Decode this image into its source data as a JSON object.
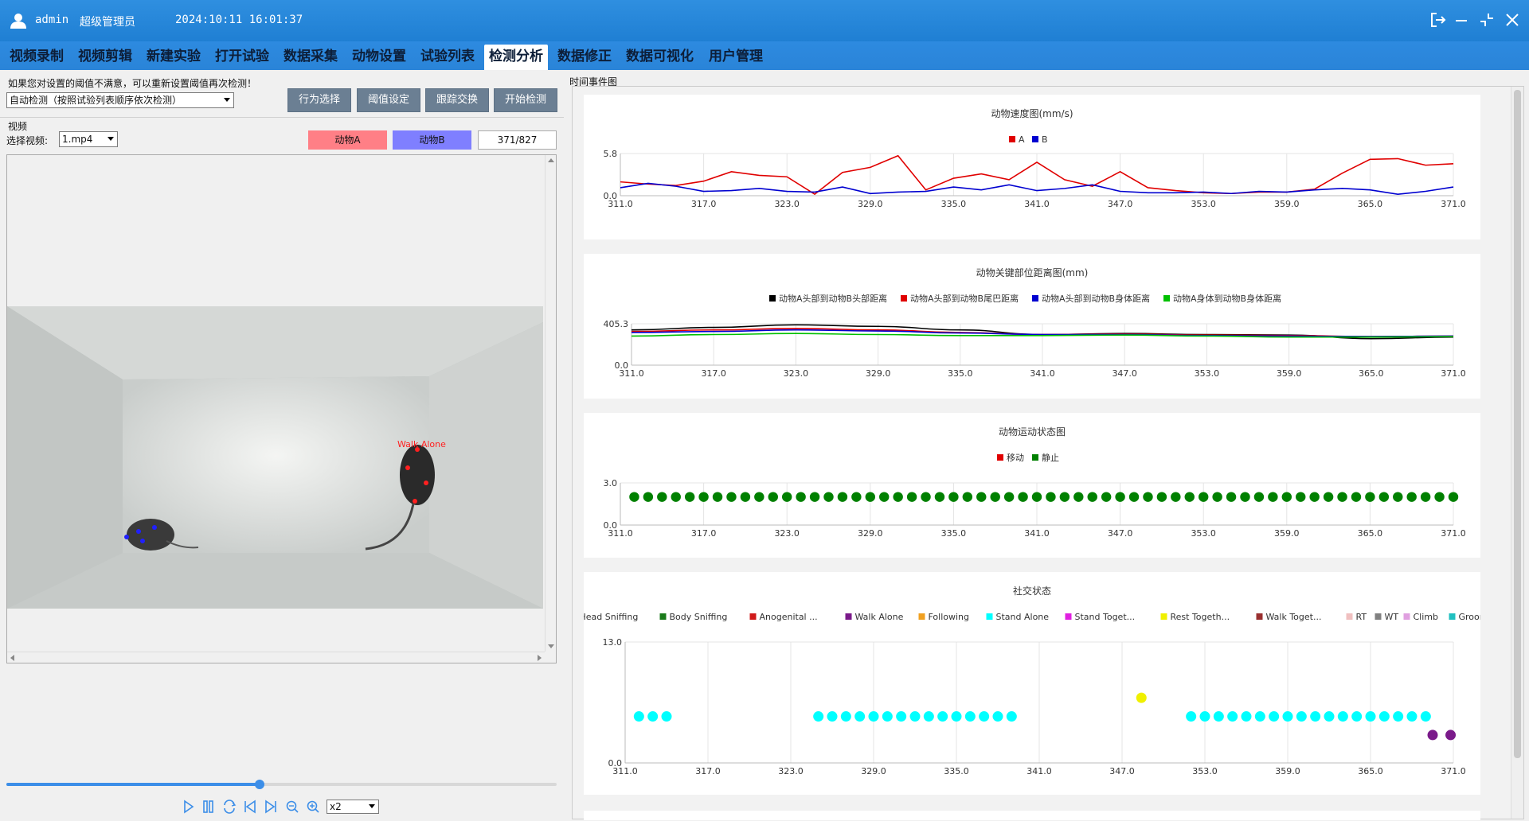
{
  "titlebar": {
    "user": "admin",
    "role": "超级管理员",
    "datetime": "2024:10:11 16:01:37"
  },
  "menu": {
    "items": [
      "视频录制",
      "视频剪辑",
      "新建实验",
      "打开试验",
      "数据采集",
      "动物设置",
      "试验列表",
      "检测分析",
      "数据修正",
      "数据可视化",
      "用户管理"
    ],
    "active": 7
  },
  "left": {
    "hint": "如果您对设置的阈值不满意，可以重新设置阈值再次检测！",
    "mode_select": "自动检测（按照试验列表顺序依次检测）",
    "buttons": {
      "behavior": "行为选择",
      "threshold": "阈值设定",
      "track_swap": "跟踪交换",
      "start": "开始检测"
    },
    "video_group": "视频",
    "select_video_label": "选择视频:",
    "video_file": "1.mp4",
    "animal_a": "动物A",
    "animal_b": "动物B",
    "frame_counter": "371/827",
    "overlay_label": "Walk Alone",
    "speed": "x2",
    "progress": 0.46,
    "colors": {
      "animal_a": "#ff7f86",
      "animal_b": "#7f7fff"
    }
  },
  "right": {
    "section_title": "时间事件图"
  },
  "chart_data": [
    {
      "type": "line",
      "title": "动物速度图(mm/s)",
      "x": [
        311,
        313,
        315,
        317,
        319,
        321,
        323,
        325,
        327,
        329,
        331,
        333,
        335,
        337,
        339,
        341,
        343,
        345,
        347,
        349,
        351,
        353,
        355,
        357,
        359,
        361,
        363,
        365,
        367,
        369,
        371
      ],
      "ylim": [
        0,
        5.8
      ],
      "x_ticks": [
        "311.0",
        "317.0",
        "323.0",
        "329.0",
        "335.0",
        "341.0",
        "347.0",
        "353.0",
        "359.0",
        "365.0",
        "371.0"
      ],
      "y_ticks": [
        "0.0",
        "5.8"
      ],
      "series": [
        {
          "name": "A",
          "color": "#e00000",
          "values": [
            1.9,
            1.6,
            1.4,
            2.0,
            3.3,
            2.8,
            2.6,
            0.2,
            3.2,
            3.9,
            5.5,
            0.8,
            2.4,
            3.0,
            2.2,
            4.6,
            2.2,
            1.3,
            3.3,
            1.1,
            0.7,
            0.4,
            0.3,
            0.5,
            0.5,
            0.9,
            3.1,
            5.0,
            5.1,
            4.2,
            4.4
          ]
        },
        {
          "name": "B",
          "color": "#0000d0",
          "values": [
            1.1,
            1.7,
            1.3,
            0.6,
            0.7,
            1.0,
            0.6,
            0.5,
            1.2,
            0.3,
            0.5,
            0.6,
            1.2,
            0.8,
            1.5,
            0.7,
            1.0,
            1.5,
            0.6,
            0.4,
            0.4,
            0.5,
            0.3,
            0.6,
            0.5,
            0.8,
            1.0,
            0.8,
            0.2,
            0.6,
            1.2
          ]
        }
      ]
    },
    {
      "type": "line",
      "title": "动物关键部位距离图(mm)",
      "x": [
        311,
        317,
        323,
        329,
        335,
        341,
        347,
        353,
        359,
        365,
        371
      ],
      "ylim": [
        0,
        405.3
      ],
      "x_ticks": [
        "311.0",
        "317.0",
        "323.0",
        "329.0",
        "335.0",
        "341.0",
        "347.0",
        "353.0",
        "359.0",
        "365.0",
        "371.0"
      ],
      "y_ticks": [
        "0.0",
        "405.3"
      ],
      "series": [
        {
          "name": "动物A头部到动物B头部距离",
          "color": "#000000",
          "values": [
            345,
            370,
            395,
            380,
            345,
            300,
            310,
            300,
            295,
            260,
            275
          ]
        },
        {
          "name": "动物A头部到动物B尾巴距离",
          "color": "#e00000",
          "values": [
            330,
            345,
            360,
            345,
            320,
            300,
            305,
            295,
            290,
            280,
            285
          ]
        },
        {
          "name": "动物A头部到动物B身体距离",
          "color": "#0000d0",
          "values": [
            320,
            330,
            345,
            335,
            315,
            300,
            300,
            290,
            285,
            280,
            285
          ]
        },
        {
          "name": "动物A身体到动物B身体距离",
          "color": "#00c000",
          "values": [
            285,
            300,
            310,
            300,
            290,
            290,
            295,
            285,
            275,
            275,
            280
          ]
        }
      ]
    },
    {
      "type": "scatter",
      "title": "动物运动状态图",
      "ylim": [
        0,
        3.0
      ],
      "x_range": [
        311,
        371
      ],
      "x_ticks": [
        "311.0",
        "317.0",
        "323.0",
        "329.0",
        "335.0",
        "341.0",
        "347.0",
        "353.0",
        "359.0",
        "365.0",
        "371.0"
      ],
      "y_ticks": [
        "0.0",
        "3.0"
      ],
      "series": [
        {
          "name": "移动",
          "color": "#e00000",
          "points": []
        },
        {
          "name": "静止",
          "color": "#008000",
          "y": 2.0,
          "x_start": 312,
          "x_end": 371,
          "x_step": 1
        }
      ]
    },
    {
      "type": "scatter",
      "title": "社交状态",
      "ylim": [
        0,
        13.0
      ],
      "x_range": [
        311,
        371
      ],
      "x_ticks": [
        "311.0",
        "317.0",
        "323.0",
        "329.0",
        "335.0",
        "341.0",
        "347.0",
        "353.0",
        "359.0",
        "365.0",
        "371.0"
      ],
      "y_ticks": [
        "0.0",
        "13.0"
      ],
      "series": [
        {
          "name": "Head Sniffing",
          "color": "#1a1aa0"
        },
        {
          "name": "Body Sniffing",
          "color": "#1a7a1a"
        },
        {
          "name": "Anogenital ...",
          "color": "#d01a1a"
        },
        {
          "name": "Walk Alone",
          "color": "#7a1a8a",
          "points": [
            [
              369.5,
              3.0
            ],
            [
              370.8,
              3.0
            ]
          ]
        },
        {
          "name": "Following",
          "color": "#f0a020"
        },
        {
          "name": "Stand Alone",
          "color": "#00ffff",
          "ranges": [
            [
              312,
              314,
              5.0
            ],
            [
              325,
              339,
              5.0
            ],
            [
              352,
              369,
              5.0
            ]
          ]
        },
        {
          "name": "Stand Toget...",
          "color": "#e020e0"
        },
        {
          "name": "Rest Togeth...",
          "color": "#f0f000",
          "points": [
            [
              348.4,
              7.0
            ]
          ]
        },
        {
          "name": "Walk Toget...",
          "color": "#9a3030"
        },
        {
          "name": "RT",
          "color": "#f0c0c0"
        },
        {
          "name": "WT",
          "color": "#808080"
        },
        {
          "name": "Climb",
          "color": "#e0a0e0"
        },
        {
          "name": "Groom",
          "color": "#20c0c0"
        }
      ]
    }
  ]
}
